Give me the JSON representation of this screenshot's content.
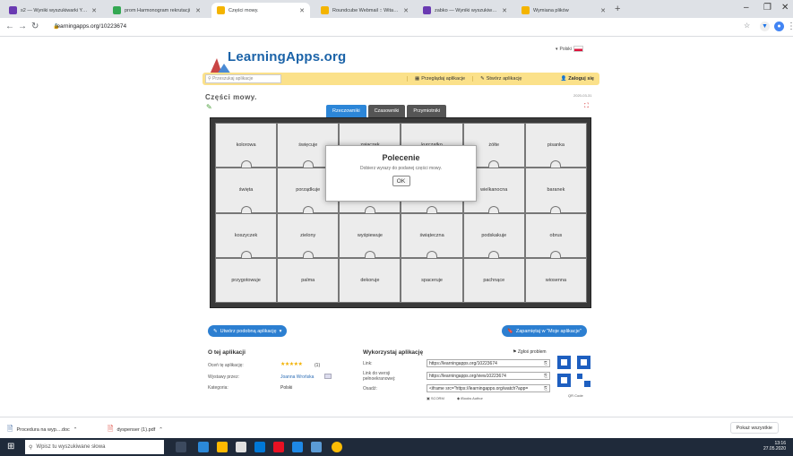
{
  "browser": {
    "tabs": [
      {
        "title": "s2 — Wyniki wyszukiwarki Yahoo",
        "color": "#6a3ab2"
      },
      {
        "title": "prom Harmonogram rekrutacji",
        "color": "#34a853"
      },
      {
        "title": "Części mowy.",
        "color": "#f4b400"
      },
      {
        "title": "Roundcube Webmail :: Witamy",
        "color": "#f4b400"
      },
      {
        "title": "zabko — Wyniki wyszukiwania Yo",
        "color": "#6a3ab2"
      },
      {
        "title": "Wymiana plików",
        "color": "#f4b400"
      }
    ],
    "url": "learningapps.org/10223674",
    "new_tab": "+"
  },
  "site": {
    "logo": "LearningApps.org",
    "language": "Polski",
    "search_placeholder": "Przeszukaj aplikacje",
    "nav": [
      {
        "label": "Przeglądaj aplikacje",
        "icon": "grid-icon"
      },
      {
        "label": "Stwórz aplikację",
        "icon": "pencil-icon"
      }
    ],
    "login": "Zaloguj się"
  },
  "app": {
    "title": "Części mowy.",
    "date": "2020-03-31",
    "category_tabs": [
      "Rzeczowniki",
      "Czasowniki",
      "Przymiotniki"
    ],
    "active_tab": 0,
    "pieces": [
      [
        "kolorowa",
        "święcuje",
        "zajączek",
        "kurczątko",
        "żółte",
        "pisanka"
      ],
      [
        "święta",
        "porządkuje",
        "",
        "",
        "wielkanocna",
        "baranek"
      ],
      [
        "koszyczek",
        "zielony",
        "wyśpiewuje",
        "świąteczna",
        "podskakuje",
        "obrus"
      ],
      [
        "przygotowuje",
        "palma",
        "dekoruje",
        "spaceruje",
        "pachnące",
        "wiosenna"
      ]
    ],
    "modal": {
      "title": "Polecenie",
      "text": "Dobierz wyrazy do podanej części mowy.",
      "ok": "OK"
    }
  },
  "actions": {
    "create_similar": "Utwórz podobną aplikację",
    "save": "Zapamiętaj w \"Moje aplikacje\""
  },
  "about": {
    "heading": "O tej aplikacji",
    "rate_label": "Oceń tę aplikację:",
    "rating_count": "(1)",
    "author_label": "Wystawy przez:",
    "author": "Joanna Wrońska",
    "category_label": "Kategoria:",
    "category": "Polski"
  },
  "use": {
    "heading": "Wykorzystaj aplikację",
    "report": "Zgłoś problem",
    "link_label": "Link:",
    "link": "https://learningapps.org/10223674",
    "fullscreen_label": "Link do wersji pełnoekranowej:",
    "fullscreen": "https://learningapps.org/view10223674",
    "embed_label": "Osadź:",
    "embed": "<iframe src=\"https://learningapps.org/watch?app=",
    "scorm": "SCORM",
    "ibooks": "iBooks Author",
    "qr": "QR Code"
  },
  "downloads": {
    "items": [
      "Procedura na wyp....doc",
      "dyspenser (1).pdf"
    ],
    "show_all": "Pokaż wszystkie"
  },
  "taskbar": {
    "search": "Wpisz tu wyszukiwane słowa",
    "time": "13:16",
    "date": "27.05.2020"
  }
}
